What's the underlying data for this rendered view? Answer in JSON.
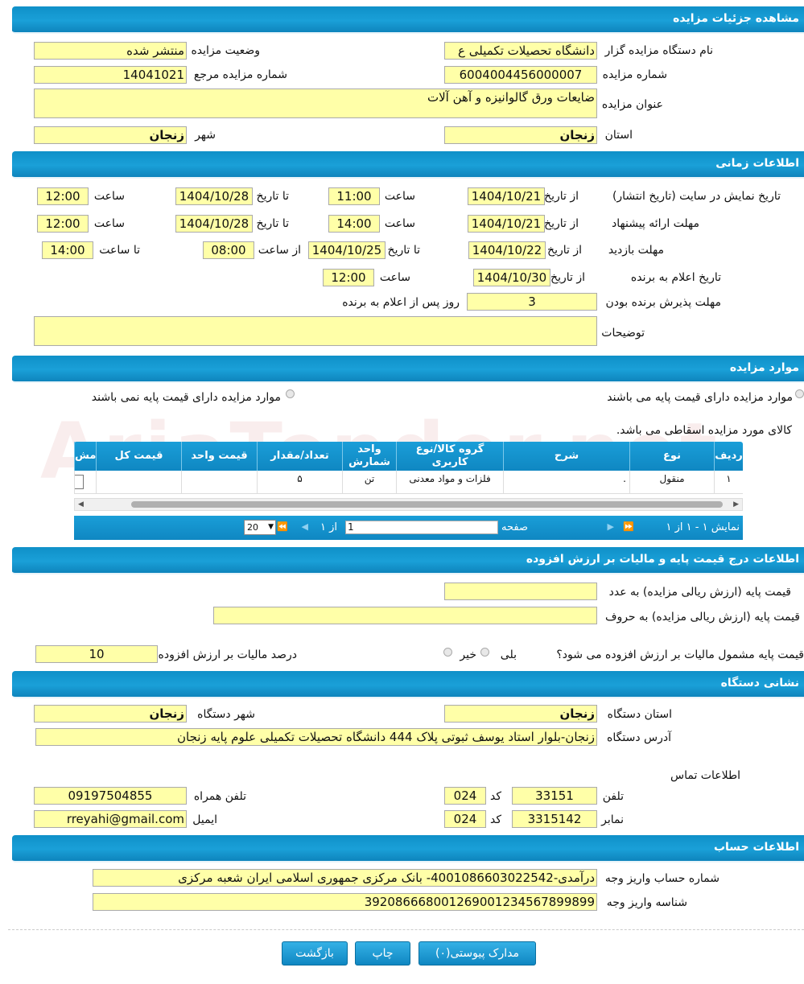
{
  "watermark": "AriaTender.net",
  "sections": {
    "details": "مشاهده جزئیات مزایده",
    "time": "اطلاعات زمانی",
    "items": "موارد مزایده",
    "price": "اطلاعات درج قیمت پایه و مالیات بر ارزش افزوده",
    "address": "نشانی دستگاه",
    "account": "اطلاعات حساب"
  },
  "details": {
    "org_label": "نام دستگاه مزایده گزار",
    "org_value": "دانشگاه تحصیلات تکمیلی ع",
    "status_label": "وضعیت مزایده",
    "status_value": "منتشر شده",
    "number_label": "شماره مزایده",
    "number_value": "6004004456000007",
    "ref_label": "شماره مزایده مرجع",
    "ref_value": "14041021",
    "title_label": "عنوان مزایده",
    "title_value": "ضایعات ورق گالوانیزه و آهن آلات",
    "province_label": "استان",
    "province_value": "زنجان",
    "city_label": "شهر",
    "city_value": "زنجان"
  },
  "time": {
    "display_label": "تاریخ نمایش در سایت (تاریخ انتشار)",
    "offer_label": "مهلت ارائه پیشنهاد",
    "visit_label": "مهلت بازدید",
    "winner_label": "تاریخ اعلام به برنده",
    "accept_label": "مهلت پذیرش برنده بودن",
    "desc_label": "توضیحات",
    "from_date": "از تاریخ",
    "to_date": "تا تاریخ",
    "hour": "ساعت",
    "from_hour": "از ساعت",
    "to_hour": "تا ساعت",
    "days_after": "روز پس از اعلام به برنده",
    "display_from": "1404/10/21",
    "display_from_time": "11:00",
    "display_to": "1404/10/28",
    "display_to_time": "12:00",
    "offer_from": "1404/10/21",
    "offer_from_time": "14:00",
    "offer_to": "1404/10/28",
    "offer_to_time": "12:00",
    "visit_from": "1404/10/22",
    "visit_to": "1404/10/25",
    "visit_from_time": "08:00",
    "visit_to_time": "14:00",
    "winner_date": "1404/10/30",
    "winner_time": "12:00",
    "accept_days": "3",
    "desc_value": ""
  },
  "items": {
    "radio_with_price": "موارد مزایده دارای قیمت پایه می باشند",
    "radio_without_price": "موارد مزایده دارای قیمت پایه نمی باشند",
    "note": "کالای مورد مزایده اسقاطی می باشد.",
    "headers": [
      "ردیف",
      "نوع",
      "شرح",
      "گروه کالا/نوع کاربری",
      "واحد شمارش",
      "تعداد/مقدار",
      "قیمت واحد",
      "قیمت کل",
      "مش"
    ],
    "rows": [
      {
        "row": "۱",
        "type": "منقول",
        "desc": ".",
        "group": "فلزات و مواد معدنی",
        "unit": "تن",
        "qty": "۵",
        "unit_price": "",
        "total": ""
      }
    ],
    "pager_info": "نمایش ۱ - ۱ از ۱",
    "page_label": "صفحه",
    "page_value": "1",
    "of_label": "از ۱",
    "page_size": "20"
  },
  "price": {
    "base_num_label": "قیمت پایه (ارزش ریالی مزایده) به عدد",
    "base_num_value": "",
    "base_text_label": "قیمت پایه (ارزش ریالی مزایده) به حروف",
    "base_text_value": "",
    "vat_question": "قیمت پایه مشمول مالیات بر ارزش افزوده می شود؟",
    "yes": "بلی",
    "no": "خیر",
    "vat_percent_label": "درصد مالیات بر ارزش افزوده",
    "vat_percent_value": "10"
  },
  "address": {
    "province_label": "استان دستگاه",
    "province_value": "زنجان",
    "city_label": "شهر دستگاه",
    "city_value": "زنجان",
    "address_label": "آدرس دستگاه",
    "address_value": "زنجان-بلوار استاد یوسف ثبوتی پلاک 444 دانشگاه تحصیلات تکمیلی علوم پایه زنجان",
    "contact_label": "اطلاعات تماس",
    "phone_label": "تلفن",
    "phone_value": "33151",
    "code_label": "کد",
    "phone_code": "024",
    "mobile_label": "تلفن همراه",
    "mobile_value": "09197504855",
    "fax_label": "نمابر",
    "fax_value": "3315142",
    "fax_code": "024",
    "email_label": "ایمیل",
    "email_value": "rreyahi@gmail.com"
  },
  "account": {
    "acc_label": "شماره حساب واریز وجه",
    "acc_value": "درآمدی-4001086603022542- بانک مرکزی جمهوری اسلامی ایران شعبه مرکزی",
    "id_label": "شناسه واریز وجه",
    "id_value": "392086668001269001234567899899"
  },
  "buttons": {
    "attachments": "مدارک پیوستی(۰)",
    "print": "چاپ",
    "back": "بازگشت"
  }
}
